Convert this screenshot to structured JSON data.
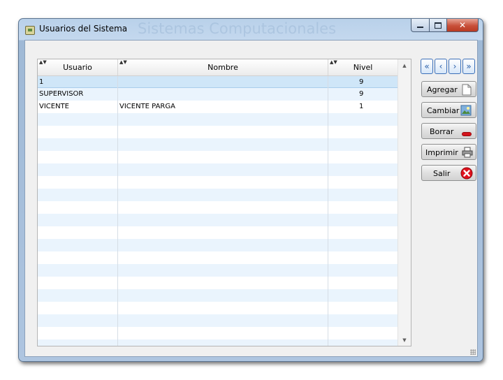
{
  "window": {
    "title": "Usuarios del Sistema",
    "watermark": "Sistemas Computacionales",
    "close_glyph": "✕"
  },
  "table": {
    "columns": [
      "Usuario",
      "Nombre",
      "Nivel"
    ],
    "rows": [
      {
        "usuario": "1",
        "nombre": "",
        "nivel": "9"
      },
      {
        "usuario": "SUPERVISOR",
        "nombre": "",
        "nivel": "9"
      },
      {
        "usuario": "VICENTE",
        "nombre": "VICENTE PARGA",
        "nivel": "1"
      }
    ],
    "selected_row": 0
  },
  "nav": {
    "first": "«",
    "prev": "‹",
    "next": "›",
    "last": "»"
  },
  "actions": {
    "agregar": "Agregar",
    "cambiar": "Cambiar",
    "borrar": "Borrar",
    "imprimir": "Imprimir",
    "salir": "Salir"
  },
  "colors": {
    "selection": "#cfe6f8",
    "alt_row": "#eaf4fd",
    "close_button": "#c8503a",
    "nav_blue": "#2a5fa8"
  }
}
